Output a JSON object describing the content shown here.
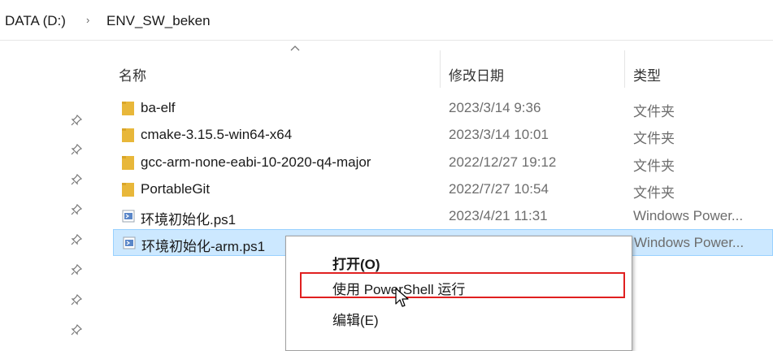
{
  "breadcrumb": {
    "items": [
      "DATA (D:)",
      "ENV_SW_beken"
    ],
    "separator": "›"
  },
  "columns": {
    "name": "名称",
    "date": "修改日期",
    "type": "类型"
  },
  "files": [
    {
      "name": "ba-elf",
      "date": "2023/3/14 9:36",
      "type": "文件夹",
      "icon": "folder-icon"
    },
    {
      "name": "cmake-3.15.5-win64-x64",
      "date": "2023/3/14 10:01",
      "type": "文件夹",
      "icon": "folder-icon"
    },
    {
      "name": "gcc-arm-none-eabi-10-2020-q4-major",
      "date": "2022/12/27 19:12",
      "type": "文件夹",
      "icon": "folder-icon"
    },
    {
      "name": "PortableGit",
      "date": "2022/7/27 10:54",
      "type": "文件夹",
      "icon": "folder-icon"
    },
    {
      "name": "环境初始化.ps1",
      "date": "2023/4/21 11:31",
      "type": "Windows Power...",
      "icon": "powershell-file-icon"
    },
    {
      "name": "环境初始化-arm.ps1",
      "date": "",
      "type": "Windows Power...",
      "icon": "powershell-file-icon",
      "selected": true
    }
  ],
  "context_menu": {
    "items": [
      {
        "label": "打开(O)",
        "bold": true
      },
      {
        "label": "使用 PowerShell 运行",
        "highlighted": true
      },
      {
        "label": "编辑(E)"
      }
    ]
  },
  "colors": {
    "selection_bg": "#cce8ff",
    "selection_border": "#99d1ff",
    "highlight_border": "#e02020",
    "folder": "#e8b73a"
  }
}
